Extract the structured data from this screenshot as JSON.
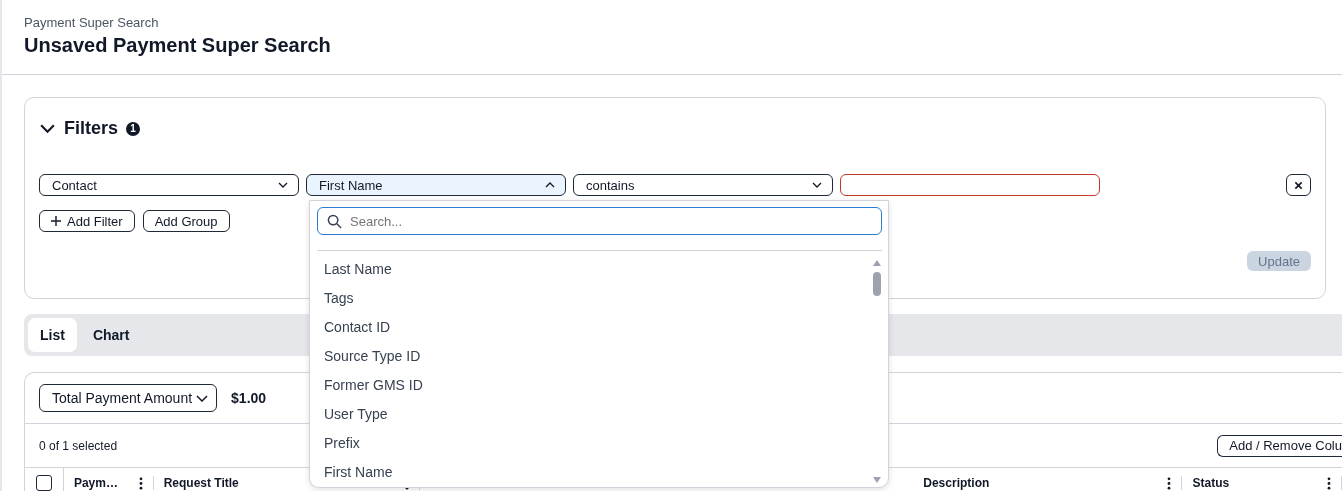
{
  "header": {
    "breadcrumb": "Payment Super Search",
    "title": "Unsaved Payment Super Search"
  },
  "filters": {
    "title": "Filters",
    "expanded": true,
    "badge": "1",
    "rows": [
      {
        "field": "Contact",
        "subfield": "First Name",
        "subfield_open": true,
        "operator": "contains",
        "invalid": true
      }
    ],
    "buttons": [
      {
        "label": "Add Filter",
        "kind": "add"
      },
      {
        "label": "Add Group",
        "kind": "plain"
      }
    ],
    "update": {
      "label": "Update",
      "disabled": true
    }
  },
  "dropdown": {
    "placeholder": "Search...",
    "options": [
      "Last Name",
      "Tags",
      "Contact ID",
      "Source Type ID",
      "Former GMS ID",
      "User Type",
      "Prefix",
      "First Name"
    ]
  },
  "tabs": [
    {
      "label": "List",
      "selected": true
    },
    {
      "label": "Chart",
      "selected": false
    }
  ],
  "summary": {
    "metric": "Total Payment Amount",
    "value": "$1.00"
  },
  "selection": "0 of 1 selected",
  "columns_button": "Add / Remove Colu",
  "table": {
    "select_all": {
      "checked": false
    },
    "columns": [
      {
        "label": "Paym…"
      },
      {
        "label": "Request Title"
      },
      {
        "label": "Description"
      },
      {
        "label": "Status"
      }
    ]
  }
}
